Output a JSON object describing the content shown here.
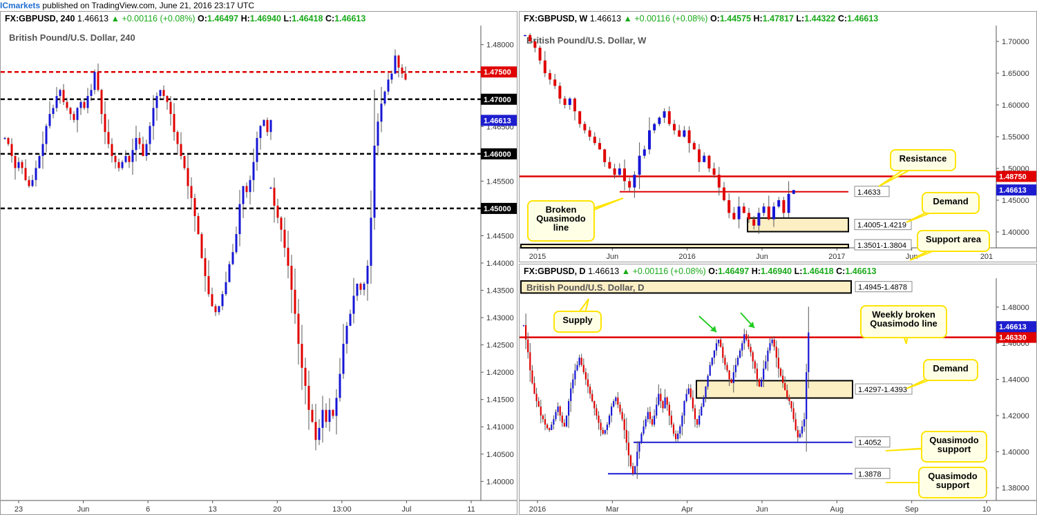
{
  "header": {
    "brand": "ICmarkets",
    "rest": " published on TradingView.com, June 21, 2016 23:17 UTC"
  },
  "colors": {
    "bull": "#1616d6",
    "bear": "#e00000",
    "resistance": "#e00000",
    "zone_fill": "#fcefc4",
    "callout_border": "#ffe400",
    "callout_fill": "#ffffe6",
    "price_tag": "#1d1dcf",
    "blue_line": "#1b1bd0"
  },
  "panels": {
    "h4": {
      "symbol": "FX:GBPUSD, 240",
      "last": "1.46613",
      "change": "▲ +0.00116 (+0.08%)",
      "o": "1.46497",
      "h": "1.46940",
      "l": "1.46418",
      "c": "1.46613",
      "title": "British Pound/U.S. Dollar, 240"
    },
    "weekly": {
      "symbol": "FX:GBPUSD, W",
      "last": "1.46613",
      "change": "▲ +0.00116 (+0.08%)",
      "o": "1.44575",
      "h": "1.47817",
      "l": "1.44322",
      "c": "1.46613",
      "title": "British Pound/U.S. Dollar, W"
    },
    "daily": {
      "symbol": "FX:GBPUSD, D",
      "last": "1.46613",
      "change": "▲ +0.00116 (+0.08%)",
      "o": "1.46497",
      "h": "1.46940",
      "l": "1.46418",
      "c": "1.46613",
      "title": "British Pound/U.S. Dollar, D"
    }
  },
  "chart_data": [
    {
      "id": "h4",
      "type": "candlestick",
      "title": "British Pound/U.S. Dollar, 240",
      "ylim": [
        1.3965,
        1.4835
      ],
      "y_ticks": [
        "1.48000",
        "1.47500",
        "1.47000",
        "1.46500",
        "1.46000",
        "1.45500",
        "1.45000",
        "1.44500",
        "1.44000",
        "1.43500",
        "1.43000",
        "1.42500",
        "1.42000",
        "1.41500",
        "1.41000",
        "1.40500",
        "1.40000"
      ],
      "x_ticks": [
        "23",
        "Jun",
        "6",
        "13",
        "20",
        "13:00",
        "Jul",
        "11"
      ],
      "levels": [
        {
          "value": 1.475,
          "label": "1.47500",
          "color": "#e00000",
          "dash": true
        },
        {
          "value": 1.47,
          "label": "1.47000",
          "color": "#000000",
          "dash": true
        },
        {
          "value": 1.46,
          "label": "1.46000",
          "color": "#000000",
          "dash": true
        },
        {
          "value": 1.45,
          "label": "1.45000",
          "color": "#000000",
          "dash": true
        }
      ],
      "last_price": {
        "value": 1.46613,
        "label": "1.46613"
      },
      "series": [
        {
          "name": "rally",
          "start_price": 1.464,
          "steps": [
            -1,
            -1,
            -2,
            -2,
            1,
            -1,
            -2,
            -1,
            1,
            2,
            2,
            2,
            3,
            2,
            1,
            2,
            1,
            -2,
            -1,
            -1,
            -1,
            2,
            1,
            -1,
            2,
            1,
            3,
            -3,
            -4,
            -3,
            -2,
            -2,
            -1,
            -1,
            1,
            1,
            -1,
            2,
            2,
            -1,
            -2,
            2,
            3,
            3,
            2,
            1,
            -1,
            -1,
            -2,
            -3,
            -2,
            -2,
            -2,
            -3,
            -2,
            -3,
            -3,
            -4,
            -3,
            -3,
            -2,
            -1,
            1,
            2,
            2,
            3,
            2,
            3,
            5,
            3,
            -1,
            2,
            3,
            4,
            2,
            1,
            -2,
            2
          ]
        },
        {
          "name": "drop",
          "start_price": 1.456,
          "steps": [
            -2,
            -3,
            -2,
            -2,
            -3,
            -3,
            -4,
            -4,
            -5,
            -4,
            -3,
            -4,
            -2,
            -3,
            2,
            3,
            -2,
            2,
            -1,
            3,
            4,
            5,
            3,
            2,
            3,
            2,
            -1,
            1,
            3,
            8,
            12,
            4,
            3,
            2,
            2,
            1,
            3,
            -2,
            -1,
            -1
          ]
        }
      ]
    },
    {
      "id": "weekly",
      "type": "candlestick",
      "title": "British Pound/U.S. Dollar, W",
      "ylim": [
        1.375,
        1.725
      ],
      "y_ticks": [
        "1.70000",
        "1.65000",
        "1.60000",
        "1.55000",
        "1.50000",
        "1.45000",
        "1.40000"
      ],
      "x_ticks": [
        "2015",
        "Jun",
        "2016",
        "Jun",
        "2017",
        "Jun",
        "201"
      ],
      "levels": [
        {
          "value": 1.4875,
          "label": "1.48750",
          "color": "#e00000",
          "dash": false
        },
        {
          "value": 1.4633,
          "label": "1.4633",
          "color": "#e00000",
          "dash": false
        }
      ],
      "zones": [
        {
          "label": "1.4005-1.4219",
          "low": 1.4005,
          "high": 1.4219
        },
        {
          "label": "1.3501-1.3804",
          "low": 1.3501,
          "high": 1.3804
        }
      ],
      "last_price": {
        "value": 1.46613,
        "label": "1.46613"
      },
      "annotations": [
        "Resistance",
        "Demand",
        "Support area",
        "Broken Quasimodo line"
      ],
      "series_trend": [
        1.71,
        1.7,
        1.69,
        1.67,
        1.65,
        1.64,
        1.63,
        1.61,
        1.6,
        1.61,
        1.59,
        1.57,
        1.56,
        1.55,
        1.54,
        1.53,
        1.51,
        1.5,
        1.49,
        1.5,
        1.48,
        1.47,
        1.49,
        1.52,
        1.53,
        1.56,
        1.57,
        1.58,
        1.59,
        1.57,
        1.56,
        1.55,
        1.56,
        1.54,
        1.53,
        1.51,
        1.52,
        1.5,
        1.49,
        1.47,
        1.45,
        1.43,
        1.42,
        1.44,
        1.43,
        1.42,
        1.41,
        1.43,
        1.44,
        1.42,
        1.44,
        1.45,
        1.43,
        1.46,
        1.466
      ]
    },
    {
      "id": "daily",
      "type": "candlestick",
      "title": "British Pound/U.S. Dollar, D",
      "ylim": [
        1.373,
        1.496
      ],
      "y_ticks": [
        "1.48000",
        "1.46000",
        "1.44000",
        "1.42000",
        "1.40000",
        "1.38000"
      ],
      "x_ticks": [
        "2016",
        "Mar",
        "Apr",
        "Jun",
        "Aug",
        "Sep",
        "10"
      ],
      "levels": [
        {
          "value": 1.4633,
          "label": "1.46330",
          "color": "#e00000",
          "dash": false
        },
        {
          "value": 1.4052,
          "label": "1.4052",
          "color": "#1b1bd0",
          "dash": false
        },
        {
          "value": 1.3878,
          "label": "1.3878",
          "color": "#1b1bd0",
          "dash": false
        }
      ],
      "zones": [
        {
          "label": "1.4945-1.4878",
          "low": 1.4878,
          "high": 1.4945
        },
        {
          "label": "1.4297-1.4393",
          "low": 1.4297,
          "high": 1.4393
        }
      ],
      "last_price": {
        "value": 1.46613,
        "label": "1.46613"
      },
      "annotations": [
        "Supply",
        "Weekly broken Quasimodo line",
        "Demand",
        "Quasimodo support",
        "Quasimodo support"
      ],
      "series_trend": [
        1.47,
        1.462,
        1.455,
        1.445,
        1.438,
        1.432,
        1.428,
        1.425,
        1.42,
        1.418,
        1.415,
        1.413,
        1.412,
        1.415,
        1.418,
        1.422,
        1.425,
        1.42,
        1.416,
        1.414,
        1.42,
        1.428,
        1.435,
        1.44,
        1.445,
        1.448,
        1.452,
        1.448,
        1.444,
        1.44,
        1.436,
        1.432,
        1.428,
        1.424,
        1.42,
        1.416,
        1.412,
        1.41,
        1.412,
        1.415,
        1.42,
        1.425,
        1.428,
        1.43,
        1.426,
        1.422,
        1.418,
        1.412,
        1.405,
        1.398,
        1.392,
        1.388,
        1.392,
        1.4,
        1.405,
        1.41,
        1.414,
        1.418,
        1.422,
        1.418,
        1.415,
        1.42,
        1.426,
        1.432,
        1.428,
        1.424,
        1.43,
        1.426,
        1.42,
        1.415,
        1.41,
        1.407,
        1.41,
        1.414,
        1.42,
        1.428,
        1.432,
        1.435,
        1.43,
        1.424,
        1.418,
        1.415,
        1.42,
        1.425,
        1.43,
        1.436,
        1.442,
        1.448,
        1.452,
        1.456,
        1.46,
        1.462,
        1.458,
        1.452,
        1.448,
        1.445,
        1.44,
        1.438,
        1.444,
        1.448,
        1.452,
        1.456,
        1.46,
        1.465,
        1.462,
        1.458,
        1.455,
        1.45,
        1.446,
        1.44,
        1.436,
        1.44,
        1.446,
        1.45,
        1.456,
        1.46,
        1.462,
        1.458,
        1.452,
        1.446,
        1.442,
        1.438,
        1.434,
        1.43,
        1.428,
        1.424,
        1.418,
        1.412,
        1.408,
        1.41,
        1.414,
        1.418,
        1.444,
        1.466
      ]
    }
  ]
}
